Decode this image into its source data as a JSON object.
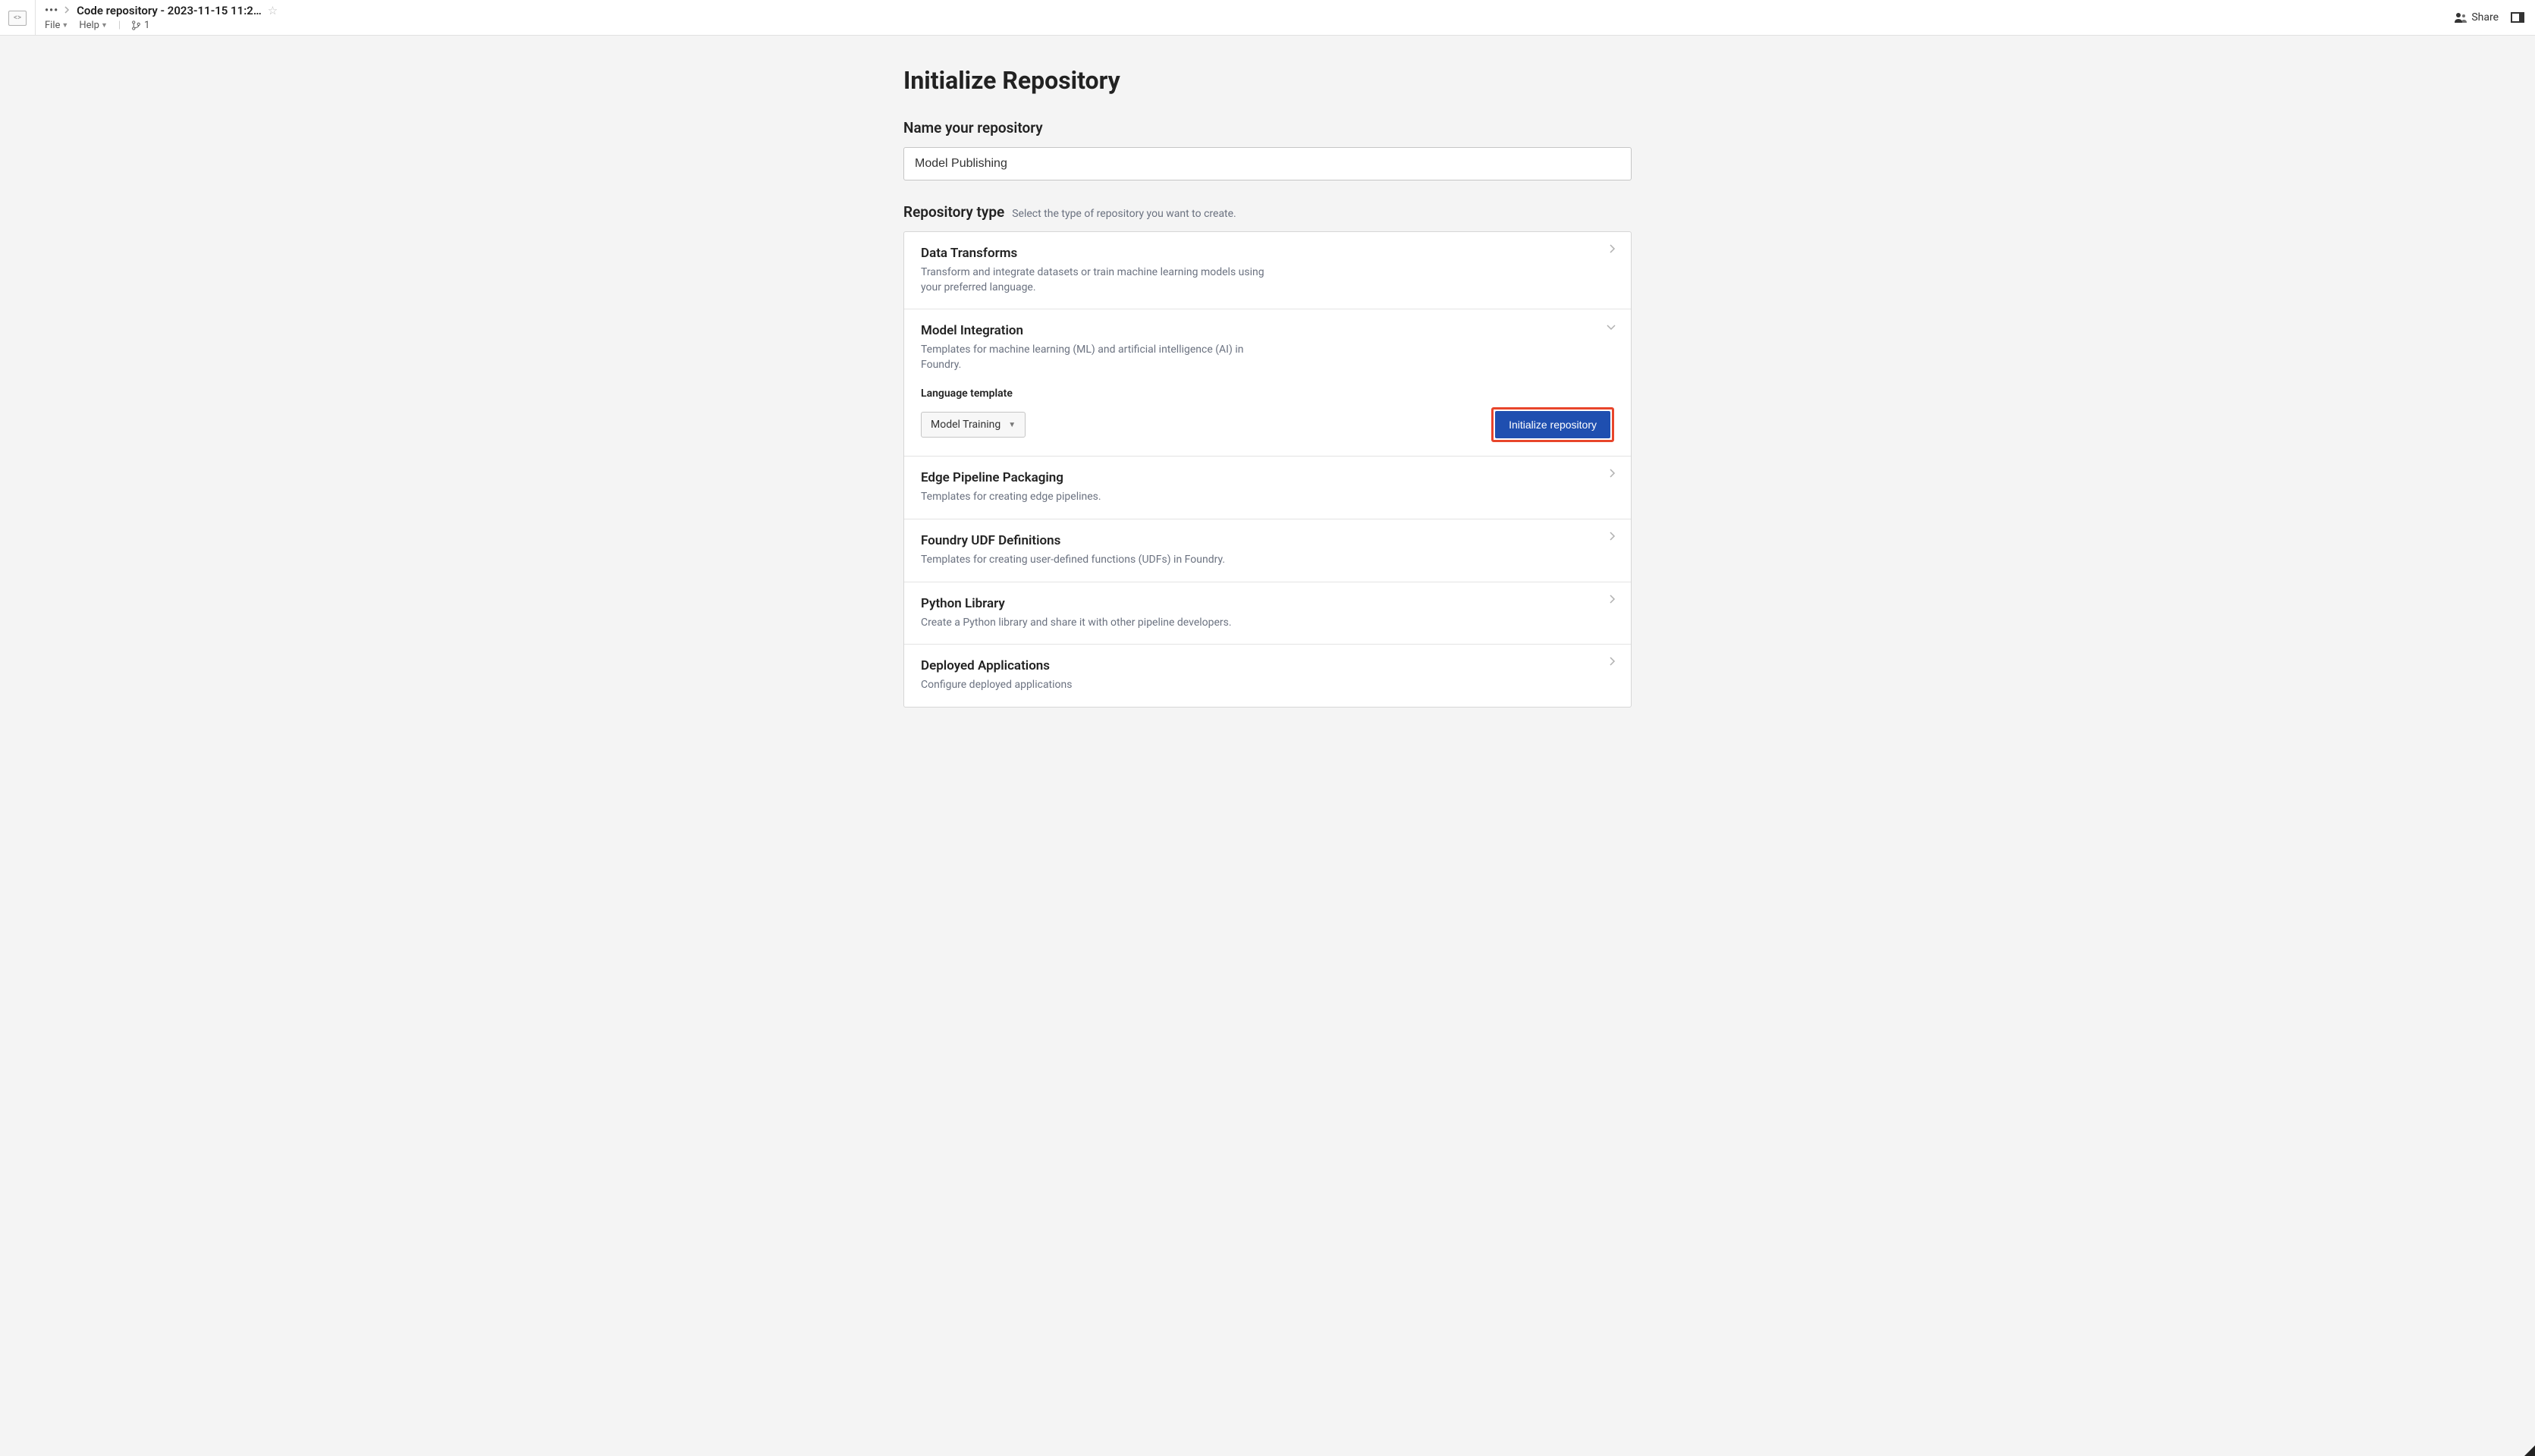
{
  "header": {
    "breadcrumb_title": "Code repository - 2023-11-15 11:2…",
    "menu": {
      "file": "File",
      "help": "Help"
    },
    "branch_count": "1",
    "share": "Share"
  },
  "page": {
    "title": "Initialize Repository",
    "name_label": "Name your repository",
    "name_value": "Model Publishing",
    "type_label": "Repository type",
    "type_sub": "Select the type of repository you want to create."
  },
  "expanded": {
    "lang_label": "Language template",
    "lang_value": "Model Training",
    "init_button": "Initialize repository"
  },
  "types": [
    {
      "title": "Data Transforms",
      "desc": "Transform and integrate datasets or train machine learning models using your preferred language.",
      "expanded": false
    },
    {
      "title": "Model Integration",
      "desc": "Templates for machine learning (ML) and artificial intelligence (AI) in Foundry.",
      "expanded": true
    },
    {
      "title": "Edge Pipeline Packaging",
      "desc": "Templates for creating edge pipelines.",
      "expanded": false
    },
    {
      "title": "Foundry UDF Definitions",
      "desc": "Templates for creating user-defined functions (UDFs) in Foundry.",
      "expanded": false
    },
    {
      "title": "Python Library",
      "desc": "Create a Python library and share it with other pipeline developers.",
      "expanded": false
    },
    {
      "title": "Deployed Applications",
      "desc": "Configure deployed applications",
      "expanded": false
    }
  ]
}
